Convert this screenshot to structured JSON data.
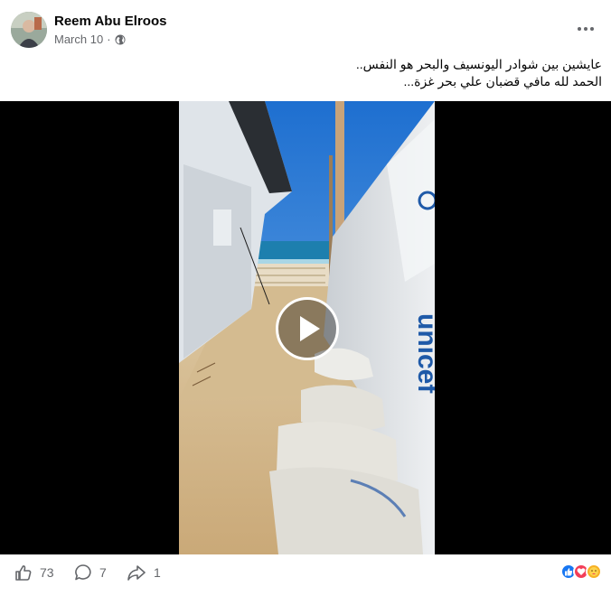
{
  "post": {
    "author": "Reem Abu Elroos",
    "date": "March 10",
    "separator": "·",
    "privacy_icon": "globe-icon",
    "more_icon": "ellipsis-icon",
    "caption_lines": [
      "عايشين بين شوادر اليونسيف والبحر هو النفس..",
      "الحمد لله مافي قضبان علي بحر غزة..."
    ]
  },
  "video": {
    "play_icon": "play-icon",
    "tarp_text": "unicef"
  },
  "footer": {
    "like_count": "73",
    "comment_count": "7",
    "share_count": "1",
    "reactions": [
      "like",
      "love",
      "care"
    ]
  },
  "colors": {
    "meta_gray": "#65676b",
    "like_blue": "#1877f2",
    "love_red": "#f33e58",
    "care_yellow": "#f7b125",
    "unicef_blue": "#1f5aa8"
  }
}
